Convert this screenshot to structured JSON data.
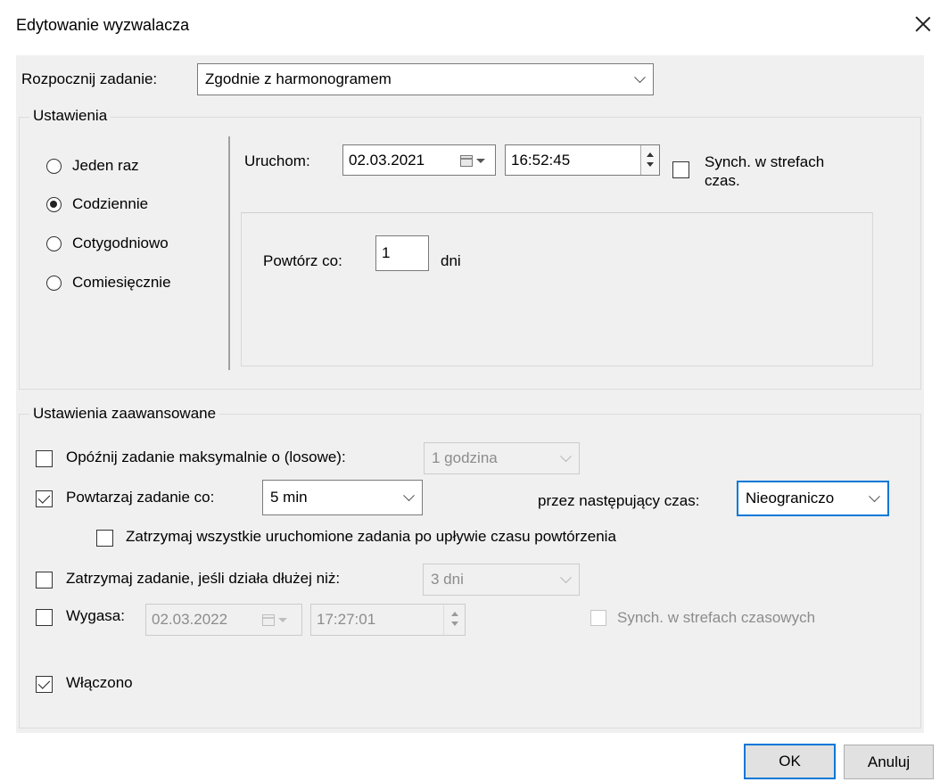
{
  "window": {
    "title": "Edytowanie wyzwalacza"
  },
  "start_task": {
    "label": "Rozpocznij zadanie:",
    "value": "Zgodnie z harmonogramem"
  },
  "settings": {
    "title": "Ustawienia",
    "radios": [
      {
        "label": "Jeden raz",
        "checked": false
      },
      {
        "label": "Codziennie",
        "checked": true
      },
      {
        "label": "Cotygodniowo",
        "checked": false
      },
      {
        "label": "Comiesięcznie",
        "checked": false
      }
    ],
    "start_label": "Uruchom:",
    "start_date": "02.03.2021",
    "start_time": "16:52:45",
    "sync_label": "Synch. w strefach czas.",
    "repeat_label": "Powtórz co:",
    "repeat_value": "1",
    "repeat_unit": "dni"
  },
  "advanced": {
    "title": "Ustawienia zaawansowane",
    "delay": {
      "label": "Opóźnij zadanie maksymalnie o (losowe):",
      "value": "1 godzina",
      "checked": false
    },
    "repeat": {
      "label": "Powtarzaj zadanie co:",
      "value": "5 min",
      "checked": true,
      "duration_label": "przez następujący czas:",
      "duration_value": "Nieograniczo"
    },
    "stop_all": {
      "label": "Zatrzymaj wszystkie uruchomione zadania po upływie czasu powtórzenia",
      "checked": false
    },
    "stop_longer": {
      "label": "Zatrzymaj zadanie, jeśli działa dłużej niż:",
      "value": "3 dni",
      "checked": false
    },
    "expire": {
      "label": "Wygasa:",
      "date": "02.03.2022",
      "time": "17:27:01",
      "checked": false,
      "sync_label": "Synch. w strefach czasowych"
    },
    "enabled": {
      "label": "Włączono",
      "checked": true
    }
  },
  "buttons": {
    "ok": "OK",
    "cancel": "Anuluj"
  }
}
